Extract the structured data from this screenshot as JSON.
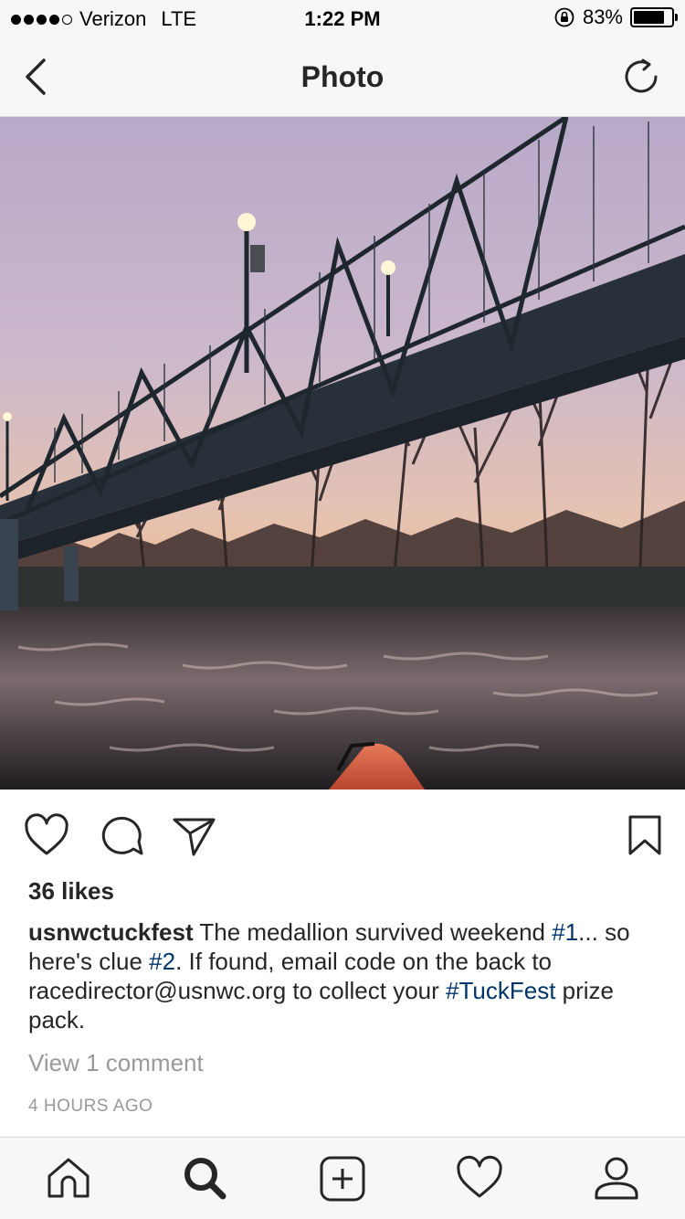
{
  "status_bar": {
    "carrier": "Verizon",
    "network": "LTE",
    "time": "1:22 PM",
    "battery_percent": "83%",
    "battery_level": 0.83
  },
  "header": {
    "title": "Photo",
    "back_icon": "chevron-left-icon",
    "refresh_icon": "refresh-icon"
  },
  "post": {
    "image_icon": "photo",
    "likes": "36 likes",
    "caption": {
      "username": "usnwctuckfest",
      "text_1": " The medallion survived weekend ",
      "hashtag_1": "#1",
      "text_2": "... so here's clue ",
      "hashtag_2": "#2",
      "text_3": ". If found, email code on the back to racedirector@usnwc.org to collect your ",
      "hashtag_3": "#TuckFest",
      "text_4": " prize pack."
    },
    "view_comments": "View 1 comment",
    "timestamp": "4 HOURS AGO"
  },
  "colors": {
    "hashtag": "#003569",
    "muted": "#999999",
    "text": "#262626",
    "bar_bg": "#f7f7f7"
  },
  "tab_bar": {
    "tabs": [
      "home-icon",
      "search-icon",
      "add-post-icon",
      "activity-heart-icon",
      "profile-icon"
    ],
    "active": "search-icon"
  }
}
